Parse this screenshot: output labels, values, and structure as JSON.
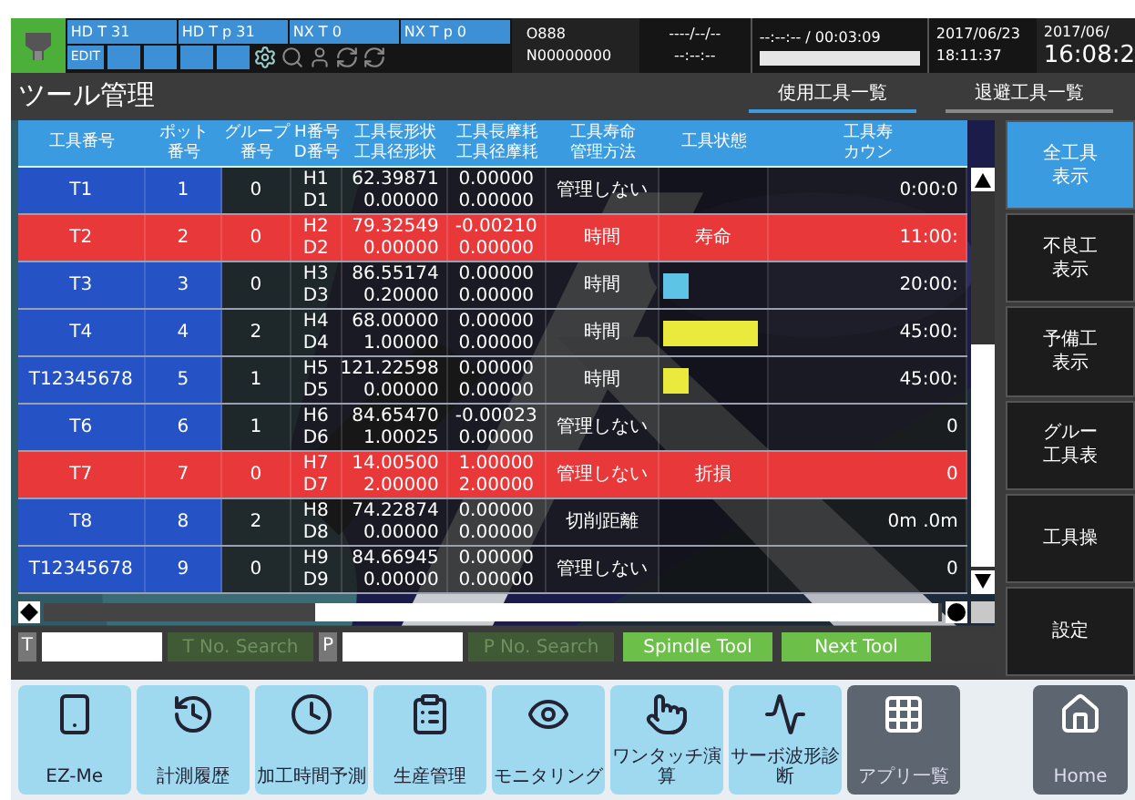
{
  "header": {
    "status_tiles": [
      "HD T 31",
      "HD T p 31",
      "NX T 0",
      "NX T p 0"
    ],
    "mode": "EDIT",
    "program": "O888",
    "sequence": "N00000000",
    "date_blank": "----/--/--",
    "time_blank": "--:--:--",
    "elapsed": "--:--:-- / 00:03:09",
    "progress": {
      "level": 0
    },
    "stamp_date": "2017/06/23",
    "stamp_time": "18:11:37",
    "clock_date": "2017/06/",
    "clock_time": "16:08:2"
  },
  "title": "ツール管理",
  "tabs": [
    {
      "label": "使用工具一覧",
      "selected": true
    },
    {
      "label": "退避工具一覧",
      "selected": false
    }
  ],
  "table": {
    "columns": [
      [
        "工具番号"
      ],
      [
        "ポット",
        "番号"
      ],
      [
        "グループ",
        "番号"
      ],
      [
        "H番号",
        "D番号"
      ],
      [
        "工具長形状",
        "工具径形状"
      ],
      [
        "工具長摩耗",
        "工具径摩耗"
      ],
      [
        "工具寿命",
        "管理方法"
      ],
      [
        "工具状態"
      ],
      [
        "工具寿",
        "カウン"
      ]
    ],
    "rows": [
      {
        "tool": "T1",
        "pot": "1",
        "group": "0",
        "h": "H1",
        "d": "D1",
        "length_shape": "62.39871",
        "diameter_shape": "0.00000",
        "length_wear": "0.00000",
        "diameter_wear": "0.00000",
        "method": "管理しない",
        "alarm": false,
        "status": {
          "kind": "none"
        },
        "count": "0:00:0"
      },
      {
        "tool": "T2",
        "pot": "2",
        "group": "0",
        "h": "H2",
        "d": "D2",
        "length_shape": "79.32549",
        "diameter_shape": "0.00000",
        "length_wear": "-0.00210",
        "diameter_wear": "0.00000",
        "method": "時間",
        "alarm": true,
        "status": {
          "kind": "text",
          "text": "寿命"
        },
        "count": "11:00:"
      },
      {
        "tool": "T3",
        "pot": "3",
        "group": "0",
        "h": "H3",
        "d": "D3",
        "length_shape": "86.55174",
        "diameter_shape": "0.20000",
        "length_wear": "0.00000",
        "diameter_wear": "0.00000",
        "method": "時間",
        "alarm": false,
        "status": {
          "kind": "bar",
          "color": "#5ec4e6",
          "level": 0.25
        },
        "count": "20:00:"
      },
      {
        "tool": "T4",
        "pot": "4",
        "group": "2",
        "h": "H4",
        "d": "D4",
        "length_shape": "68.00000",
        "diameter_shape": "1.00000",
        "length_wear": "0.00000",
        "diameter_wear": "0.00000",
        "method": "時間",
        "alarm": false,
        "status": {
          "kind": "bar",
          "color": "#eaea3c",
          "level": 0.95
        },
        "count": "45:00:"
      },
      {
        "tool": "T12345678",
        "pot": "5",
        "group": "1",
        "h": "H5",
        "d": "D5",
        "length_shape": "121.22598",
        "diameter_shape": "0.00000",
        "length_wear": "0.00000",
        "diameter_wear": "0.00000",
        "method": "時間",
        "alarm": false,
        "status": {
          "kind": "bar",
          "color": "#eaea3c",
          "level": 0.25
        },
        "count": "45:00:"
      },
      {
        "tool": "T6",
        "pot": "6",
        "group": "1",
        "h": "H6",
        "d": "D6",
        "length_shape": "84.65470",
        "diameter_shape": "1.00025",
        "length_wear": "-0.00023",
        "diameter_wear": "0.00000",
        "method": "管理しない",
        "alarm": false,
        "status": {
          "kind": "none"
        },
        "count": "0"
      },
      {
        "tool": "T7",
        "pot": "7",
        "group": "0",
        "h": "H7",
        "d": "D7",
        "length_shape": "14.00500",
        "diameter_shape": "2.00000",
        "length_wear": "1.00000",
        "diameter_wear": "2.00000",
        "method": "管理しない",
        "alarm": true,
        "status": {
          "kind": "text",
          "text": "折損"
        },
        "count": "0"
      },
      {
        "tool": "T8",
        "pot": "8",
        "group": "2",
        "h": "H8",
        "d": "D8",
        "length_shape": "74.22874",
        "diameter_shape": "0.00000",
        "length_wear": "0.00000",
        "diameter_wear": "0.00000",
        "method": "切削距離",
        "alarm": false,
        "status": {
          "kind": "none"
        },
        "count": "0m .0m"
      },
      {
        "tool": "T12345678",
        "pot": "9",
        "group": "0",
        "h": "H9",
        "d": "D9",
        "length_shape": "84.66945",
        "diameter_shape": "0.00000",
        "length_wear": "0.00000",
        "diameter_wear": "0.00000",
        "method": "管理しない",
        "alarm": false,
        "status": {
          "kind": "none"
        },
        "count": "0"
      }
    ]
  },
  "side_buttons": [
    {
      "lines": [
        "全工具",
        "表示"
      ],
      "selected": true
    },
    {
      "lines": [
        "不良工",
        "表示"
      ],
      "selected": false
    },
    {
      "lines": [
        "予備工",
        "表示"
      ],
      "selected": false
    },
    {
      "lines": [
        "グルー",
        "工具表"
      ],
      "selected": false
    },
    {
      "lines": [
        "工具操"
      ],
      "selected": false
    },
    {
      "lines": [
        "設定"
      ],
      "selected": false
    }
  ],
  "search": {
    "fields": [
      {
        "label": "T"
      },
      {
        "label": "P"
      }
    ],
    "buttons": [
      {
        "label": "T No. Search",
        "disabled": true
      },
      {
        "label": "P No. Search",
        "disabled": true
      },
      {
        "label": "Spindle Tool",
        "disabled": false
      },
      {
        "label": "Next Tool",
        "disabled": false
      }
    ]
  },
  "apps": [
    {
      "label": "EZ-Me",
      "kind": "app"
    },
    {
      "label": "計測履歴",
      "kind": "app"
    },
    {
      "label": "加工時間予測",
      "kind": "app"
    },
    {
      "label": "生産管理",
      "kind": "app"
    },
    {
      "label": "モニタリング",
      "kind": "app"
    },
    {
      "label": "ワンタッチ演算",
      "kind": "app"
    },
    {
      "label": "サーボ波形診断",
      "kind": "app"
    },
    {
      "label": "アプリ一覧",
      "kind": "system"
    },
    {
      "label": "Home",
      "kind": "system"
    }
  ]
}
